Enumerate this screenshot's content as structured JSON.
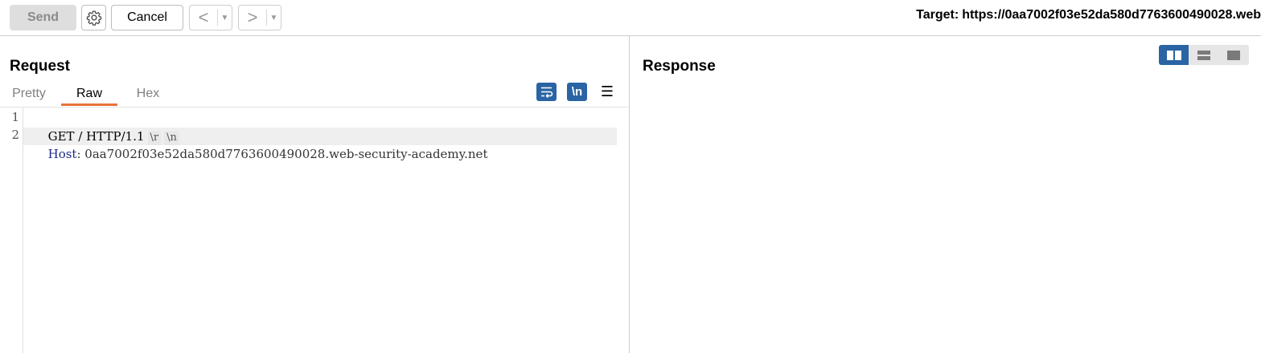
{
  "toolbar": {
    "send_label": "Send",
    "cancel_label": "Cancel",
    "prev_icon": "chevron-left-icon",
    "next_icon": "chevron-right-icon",
    "target_label": "Target:",
    "target_url": "https://0aa7002f03e52da580d7763600490028.web"
  },
  "request": {
    "title": "Request",
    "tabs": [
      {
        "label": "Pretty",
        "active": false
      },
      {
        "label": "Raw",
        "active": true
      },
      {
        "label": "Hex",
        "active": false
      }
    ],
    "newline_toggle": "\\n",
    "lines": [
      {
        "number": "1",
        "text": "GET / HTTP/1.1",
        "cr": "\\r",
        "lf": "\\n"
      },
      {
        "number": "2",
        "header_name": "Host",
        "separator": ":",
        "header_value": " 0aa7002f03e52da580d7763600490028.web-security-academy.net"
      }
    ]
  },
  "response": {
    "title": "Response"
  },
  "colors": {
    "accent": "#2a64a4",
    "active_tab_underline": "#e8733a",
    "header_name": "#1d2a8a"
  }
}
